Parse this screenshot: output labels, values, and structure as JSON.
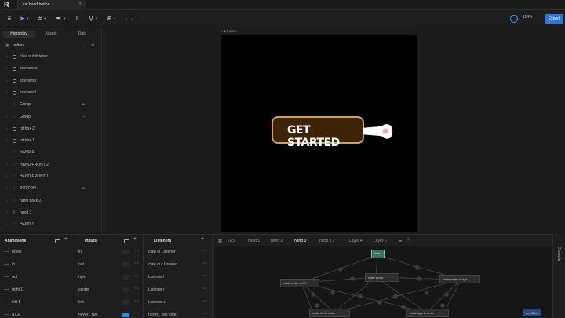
{
  "window": {
    "file_tab": "cat hand botton",
    "close": "×"
  },
  "toolbar": {
    "zoom": "114%",
    "export_label": "Export"
  },
  "left_panel": {
    "tabs": [
      "Hierarchy",
      "Assets",
      "Data"
    ],
    "root": "botton",
    "rows": [
      {
        "label": "claw out listener",
        "type": "box"
      },
      {
        "label": "listeners c",
        "type": "box"
      },
      {
        "label": "listeners r",
        "type": "box"
      },
      {
        "label": "listeners l",
        "type": "box"
      },
      {
        "label": "Group",
        "type": "grp",
        "tail": "lock"
      },
      {
        "label": "Group",
        "type": "grp",
        "tail": "eye"
      },
      {
        "label": "hit box 2",
        "type": "box"
      },
      {
        "label": "hit box 1",
        "type": "box"
      },
      {
        "label": "HAND 3",
        "type": "grp"
      },
      {
        "label": "HAND FRONT 2",
        "type": "grp"
      },
      {
        "label": "HAND FRONT 1",
        "type": "grp"
      },
      {
        "label": "BOTTON",
        "type": "grp",
        "tail": "lock"
      },
      {
        "label": "hand back 2",
        "type": "grp"
      },
      {
        "label": "hand 3",
        "type": "key"
      },
      {
        "label": "HAND 1",
        "type": "grp"
      }
    ]
  },
  "canvas": {
    "artboard_label": "botton",
    "button_text": "GET STARTED"
  },
  "animations": {
    "title": "Animations",
    "items": [
      "hover",
      "in",
      "out",
      "right 1",
      "left 1",
      "IDLE"
    ]
  },
  "inputs": {
    "title": "Inputs",
    "items": [
      "in",
      "out",
      "right",
      "center",
      "left",
      "hover , two"
    ]
  },
  "listeners": {
    "title": "Listeners",
    "items": [
      "claw in Listener",
      "claw out Listener",
      "Listener l",
      "Listener r",
      "Listener c",
      "hover , two enter"
    ]
  },
  "state_machine": {
    "tabs": [
      "TES",
      "hand 1",
      "hand 2",
      "hand 3",
      "hand 3 2",
      "Layer 4",
      "Layer 6"
    ],
    "active_tab": "hand 3",
    "nodes": {
      "entry": "Entry",
      "left": "rotate center to left",
      "center": "rotate center",
      "right": "rotate center to right",
      "bottom_left": "rotate left to center",
      "bottom_right": "rotate right to center",
      "any": "Any State"
    }
  },
  "console": {
    "label": "Console"
  }
}
